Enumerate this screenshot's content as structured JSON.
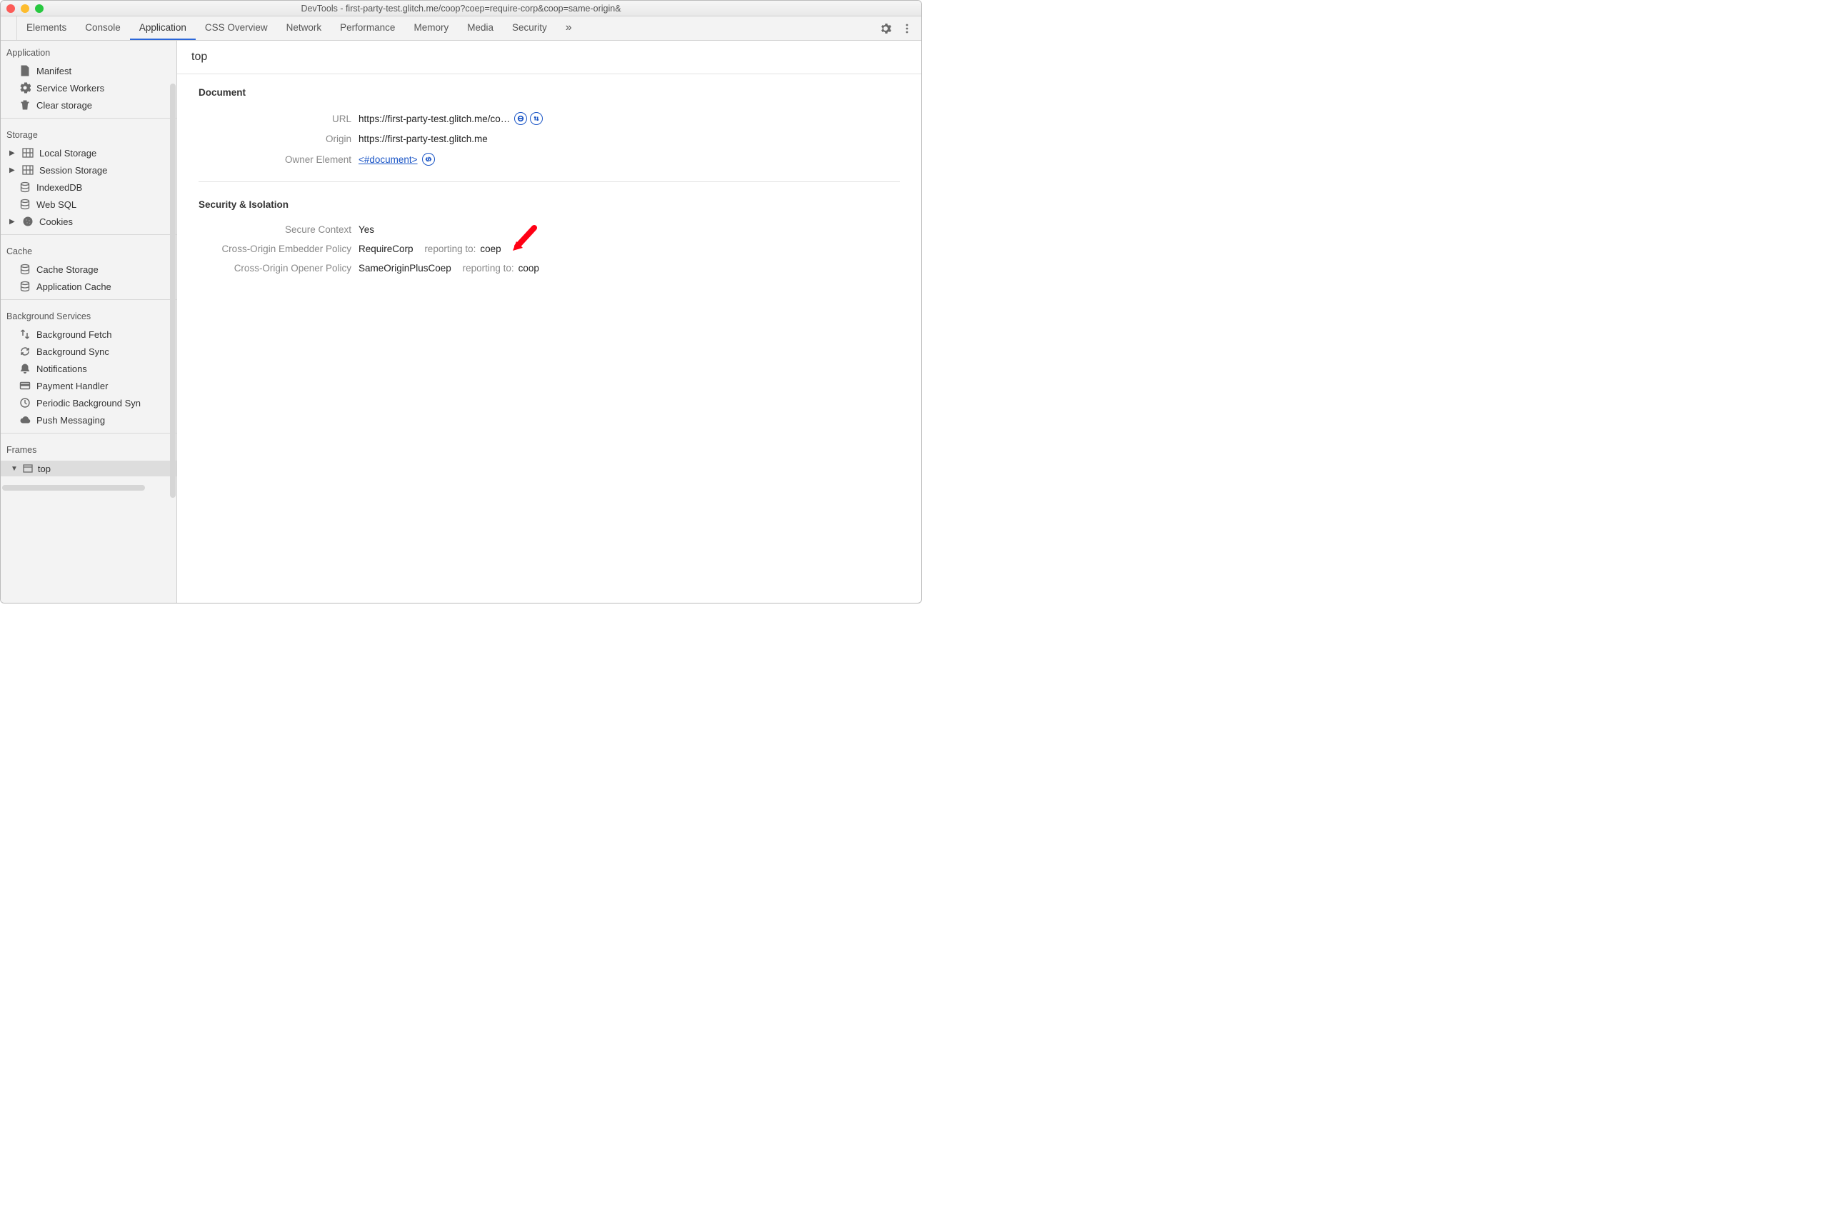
{
  "titlebar": {
    "title": "DevTools - first-party-test.glitch.me/coop?coep=require-corp&coop=same-origin&"
  },
  "tabs": {
    "items": [
      "Elements",
      "Console",
      "Application",
      "CSS Overview",
      "Network",
      "Performance",
      "Memory",
      "Media",
      "Security"
    ],
    "active": "Application"
  },
  "sidebar": {
    "groups": [
      {
        "title": "Application",
        "items": [
          {
            "icon": "file",
            "label": "Manifest"
          },
          {
            "icon": "gear",
            "label": "Service Workers"
          },
          {
            "icon": "trash",
            "label": "Clear storage"
          }
        ]
      },
      {
        "title": "Storage",
        "items": [
          {
            "icon": "grid",
            "label": "Local Storage",
            "expandable": true
          },
          {
            "icon": "grid",
            "label": "Session Storage",
            "expandable": true
          },
          {
            "icon": "db",
            "label": "IndexedDB"
          },
          {
            "icon": "db",
            "label": "Web SQL"
          },
          {
            "icon": "cookie",
            "label": "Cookies",
            "expandable": true
          }
        ]
      },
      {
        "title": "Cache",
        "items": [
          {
            "icon": "db",
            "label": "Cache Storage"
          },
          {
            "icon": "db",
            "label": "Application Cache"
          }
        ]
      },
      {
        "title": "Background Services",
        "items": [
          {
            "icon": "updown",
            "label": "Background Fetch"
          },
          {
            "icon": "sync",
            "label": "Background Sync"
          },
          {
            "icon": "bell",
            "label": "Notifications"
          },
          {
            "icon": "card",
            "label": "Payment Handler"
          },
          {
            "icon": "clock",
            "label": "Periodic Background Syn"
          },
          {
            "icon": "cloud",
            "label": "Push Messaging"
          }
        ]
      },
      {
        "title": "Frames",
        "items": []
      }
    ],
    "frames_top": "top"
  },
  "main": {
    "heading": "top",
    "document": {
      "section_title": "Document",
      "url_label": "URL",
      "url_value": "https://first-party-test.glitch.me/co…",
      "origin_label": "Origin",
      "origin_value": "https://first-party-test.glitch.me",
      "owner_label": "Owner Element",
      "owner_link": "<#document>"
    },
    "security": {
      "section_title": "Security & Isolation",
      "secure_label": "Secure Context",
      "secure_value": "Yes",
      "coep_label": "Cross-Origin Embedder Policy",
      "coep_value": "RequireCorp",
      "coep_report_prefix": "reporting to:",
      "coep_report_value": "coep",
      "coop_label": "Cross-Origin Opener Policy",
      "coop_value": "SameOriginPlusCoep",
      "coop_report_prefix": "reporting to:",
      "coop_report_value": "coop"
    }
  },
  "colors": {
    "accent": "#1a55c6",
    "annotation": "#ff0014"
  }
}
